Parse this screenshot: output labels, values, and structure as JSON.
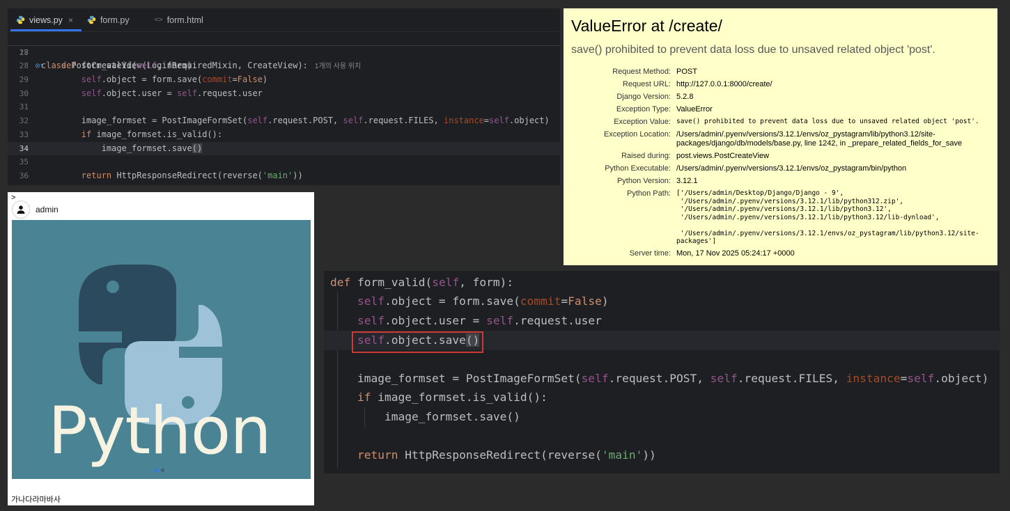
{
  "ide": {
    "tabs": [
      {
        "label": "views.py",
        "active": true,
        "closable": true,
        "icon": "python-file-icon"
      },
      {
        "label": "form.py",
        "active": false,
        "closable": false,
        "icon": "python-file-icon"
      },
      {
        "label": "form.html",
        "active": false,
        "closable": false,
        "icon": "html-file-icon"
      }
    ],
    "tab_close_glyph": "×",
    "html_icon_glyph": "<>",
    "sticky": {
      "num": "18",
      "code": "class PostCreateView(LoginRequiredMixin, CreateView):",
      "hint": "1개의 사용 위치"
    },
    "lines": [
      {
        "num": "27",
        "code": ""
      },
      {
        "num": "28",
        "code": "    def form_valid(self, form):",
        "gutter": "override-icon"
      },
      {
        "num": "29",
        "code": "        self.object = form.save(commit=False)"
      },
      {
        "num": "30",
        "code": "        self.object.user = self.request.user"
      },
      {
        "num": "31",
        "code": ""
      },
      {
        "num": "32",
        "code": "        image_formset = PostImageFormSet(self.request.POST, self.request.FILES, instance=self.object)"
      },
      {
        "num": "33",
        "code": "        if image_formset.is_valid():"
      },
      {
        "num": "34",
        "code": "            image_formset.save()",
        "current": true
      },
      {
        "num": "35",
        "code": ""
      },
      {
        "num": "36",
        "code": "        return HttpResponseRedirect(reverse('main'))"
      },
      {
        "num": "37",
        "code": ""
      }
    ],
    "gutter_glyph": "◎↑"
  },
  "error_page": {
    "title": "ValueError at /create/",
    "exception_value": "save() prohibited to prevent data loss due to unsaved related object 'post'.",
    "rows": [
      {
        "key": "Request Method:",
        "value": "POST"
      },
      {
        "key": "Request URL:",
        "value": "http://127.0.0.1:8000/create/"
      },
      {
        "key": "Django Version:",
        "value": "5.2.8"
      },
      {
        "key": "Exception Type:",
        "value": "ValueError"
      },
      {
        "key": "Exception Value:",
        "value": "save() prohibited to prevent data loss due to unsaved related object 'post'.",
        "mono": true
      },
      {
        "key": "Exception Location:",
        "value": "/Users/admin/.pyenv/versions/3.12.1/envs/oz_pystagram/lib/python3.12/site-packages/django/db/models/base.py, line 1242, in _prepare_related_fields_for_save"
      },
      {
        "key": "Raised during:",
        "value": "post.views.PostCreateView"
      },
      {
        "key": "Python Executable:",
        "value": "/Users/admin/.pyenv/versions/3.12.1/envs/oz_pystagram/bin/python"
      },
      {
        "key": "Python Version:",
        "value": "3.12.1"
      },
      {
        "key": "Python Path:",
        "value": "['/Users/admin/Desktop/Django/Django - 9',\n '/Users/admin/.pyenv/versions/3.12.1/lib/python312.zip',\n '/Users/admin/.pyenv/versions/3.12.1/lib/python3.12',\n '/Users/admin/.pyenv/versions/3.12.1/lib/python3.12/lib-dynload',\n\n '/Users/admin/.pyenv/versions/3.12.1/envs/oz_pystagram/lib/python3.12/site-packages']",
        "mono": true
      },
      {
        "key": "Server time:",
        "value": "Mon, 17 Nov 2025 05:24:17 +0000"
      }
    ]
  },
  "post": {
    "toggle": ">",
    "author": "admin",
    "image_text": "Python",
    "caption": "가나다라마바사",
    "carousel_pages": 2,
    "carousel_active": 0,
    "colors": {
      "image_bg": "#4a8393",
      "snake_dark": "#2c4a5e",
      "snake_light": "#9ec3d8",
      "wordmark": "#f7f3e3"
    }
  },
  "zoom": {
    "lines": [
      "def form_valid(self, form):",
      "    self.object = form.save(commit=False)",
      "    self.object.user = self.request.user",
      "    self.object.save()",
      "",
      "    image_formset = PostImageFormSet(self.request.POST, self.request.FILES, instance=self.object)",
      "    if image_formset.is_valid():",
      "        image_formset.save()",
      "",
      "    return HttpResponseRedirect(reverse('main'))"
    ],
    "highlighted_line": 3,
    "highlight_color": "#d03a35"
  },
  "colors": {
    "editor_bg": "#1e1f22",
    "keyword": "#cf8e6d",
    "function": "#56a8f5",
    "self": "#94558d",
    "param": "#aa4926",
    "string": "#6aab73",
    "error_bg": "#ffffc9",
    "tab_accent": "#3574f0"
  }
}
